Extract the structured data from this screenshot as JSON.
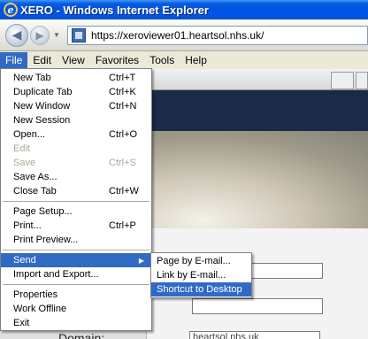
{
  "window": {
    "title": "XERO - Windows Internet Explorer"
  },
  "nav": {
    "address": "https://xeroviewer01.heartsol.nhs.uk/"
  },
  "menubar": [
    "File",
    "Edit",
    "View",
    "Favorites",
    "Tools",
    "Help"
  ],
  "file_menu": {
    "groups": [
      [
        {
          "label": "New Tab",
          "shortcut": "Ctrl+T",
          "enabled": true
        },
        {
          "label": "Duplicate Tab",
          "shortcut": "Ctrl+K",
          "enabled": true
        },
        {
          "label": "New Window",
          "shortcut": "Ctrl+N",
          "enabled": true
        },
        {
          "label": "New Session",
          "shortcut": "",
          "enabled": true
        },
        {
          "label": "Open...",
          "shortcut": "Ctrl+O",
          "enabled": true
        },
        {
          "label": "Edit",
          "shortcut": "",
          "enabled": false
        },
        {
          "label": "Save",
          "shortcut": "Ctrl+S",
          "enabled": false
        },
        {
          "label": "Save As...",
          "shortcut": "",
          "enabled": true
        },
        {
          "label": "Close Tab",
          "shortcut": "Ctrl+W",
          "enabled": true
        }
      ],
      [
        {
          "label": "Page Setup...",
          "shortcut": "",
          "enabled": true
        },
        {
          "label": "Print...",
          "shortcut": "Ctrl+P",
          "enabled": true
        },
        {
          "label": "Print Preview...",
          "shortcut": "",
          "enabled": true
        }
      ],
      [
        {
          "label": "Send",
          "shortcut": "",
          "enabled": true,
          "submenu": true,
          "highlighted": true
        },
        {
          "label": "Import and Export...",
          "shortcut": "",
          "enabled": true
        }
      ],
      [
        {
          "label": "Properties",
          "shortcut": "",
          "enabled": true
        },
        {
          "label": "Work Offline",
          "shortcut": "",
          "enabled": true
        },
        {
          "label": "Exit",
          "shortcut": "",
          "enabled": true
        }
      ]
    ]
  },
  "send_submenu": [
    {
      "label": "Page by E-mail...",
      "highlighted": false
    },
    {
      "label": "Link by E-mail...",
      "highlighted": false
    },
    {
      "label": "Shortcut to Desktop",
      "highlighted": true
    }
  ],
  "page": {
    "domain_label": "Domain:",
    "domain_value": "heartsol.nhs.uk"
  },
  "colors": {
    "highlight": "#316ac5",
    "titlebar": "#0054e3",
    "banner": "#1c2a48"
  }
}
